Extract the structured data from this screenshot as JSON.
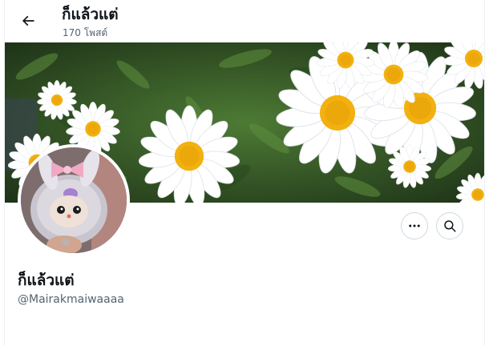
{
  "header": {
    "title": "ก็แล้วแต่",
    "post_count": "170 โพสต์"
  },
  "profile": {
    "display_name": "ก็แล้วแต่",
    "handle": "@Mairakmaiwaaaa"
  },
  "icons": {
    "back": "arrow-left-icon",
    "more": "more-horizontal-icon",
    "search": "search-icon"
  },
  "colors": {
    "text_primary": "#0f1419",
    "text_secondary": "#536471",
    "border": "#cfd9de",
    "banner_foliage": "#2f4a25",
    "daisy_center": "#f2b10f"
  },
  "banner": {
    "subject": "white-daisies"
  },
  "avatar": {
    "subject": "fluffy-plush-doll"
  }
}
